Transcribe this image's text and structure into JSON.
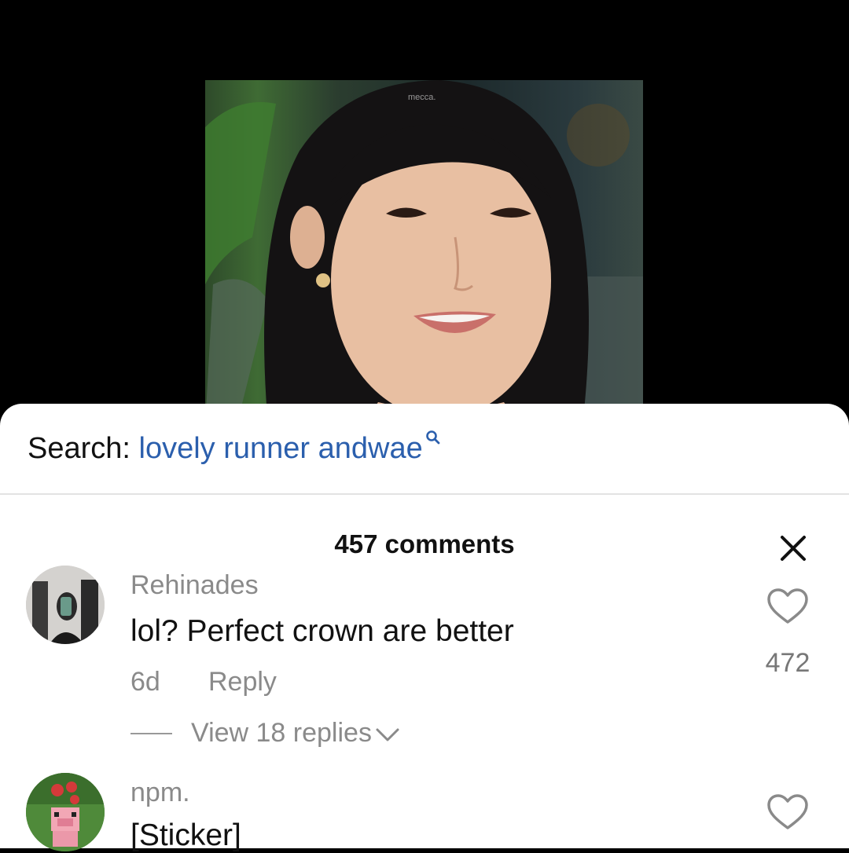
{
  "video": {
    "watermark": "mecca."
  },
  "search": {
    "prefix": "Search:",
    "term": "lovely runner andwae"
  },
  "comments_header": {
    "count_label": "457 comments"
  },
  "comments": [
    {
      "username": "Rehinades",
      "text": "lol? Perfect crown are better",
      "age": "6d",
      "reply_label": "Reply",
      "likes": "472",
      "view_replies": "View 18 replies"
    },
    {
      "username": "npm.",
      "text": "[Sticker]"
    }
  ],
  "icons": {
    "search": "search-icon",
    "close": "close-icon",
    "like": "heart-outline-icon",
    "expand": "chevron-down-icon"
  },
  "colors": {
    "link": "#2b5fad",
    "muted": "#8a8a8a",
    "sheet": "#ffffff",
    "background": "#000000"
  }
}
